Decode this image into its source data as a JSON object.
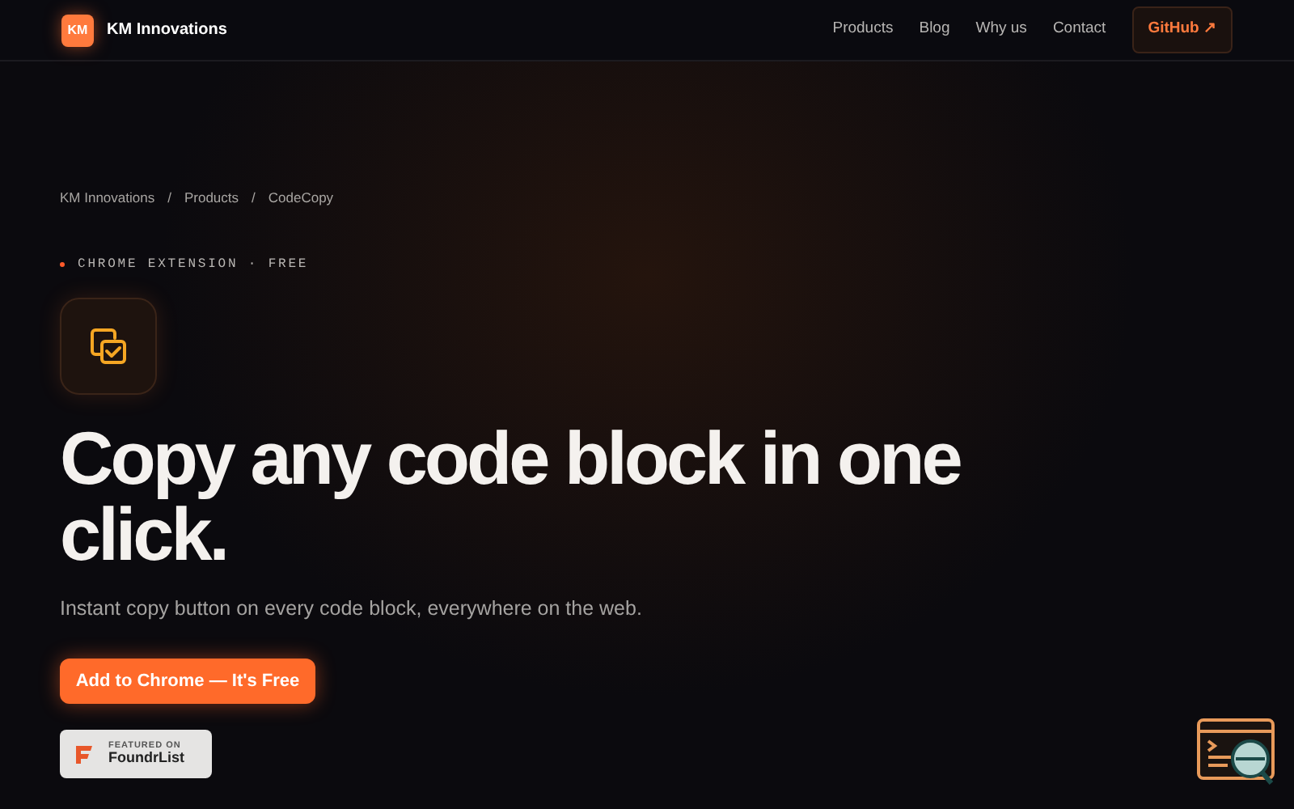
{
  "brand": {
    "logo": "KM",
    "name": "KM Innovations"
  },
  "nav": {
    "links": [
      "Products",
      "Blog",
      "Why us",
      "Contact"
    ],
    "github": "GitHub ↗"
  },
  "breadcrumb": [
    "KM Innovations",
    "Products",
    "CodeCopy"
  ],
  "breadcrumb_separators": [
    "/",
    "/"
  ],
  "eyebrow": "CHROME EXTENSION · FREE",
  "headline": "Copy any code block in one click.",
  "subtitle": "Instant copy button on every code block, everywhere on the web.",
  "cta": "Add to Chrome — It's Free",
  "featured": {
    "small": "FEATURED ON",
    "name": "FoundrList"
  }
}
